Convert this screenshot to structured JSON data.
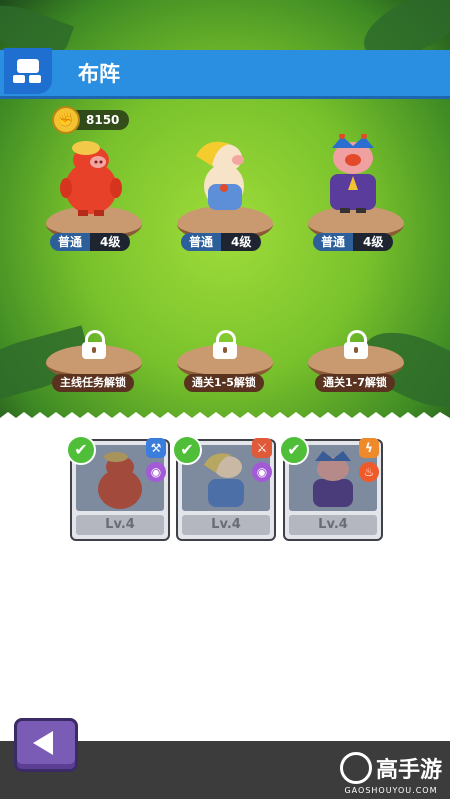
{
  "header": {
    "title": "布阵",
    "icon": "formation-icon"
  },
  "power": {
    "value": "8150",
    "icon": "fist-icon"
  },
  "slots": [
    {
      "quality": "普通",
      "level": "4级",
      "hero": "red-pig"
    },
    {
      "quality": "普通",
      "level": "4级",
      "hero": "blonde-pig"
    },
    {
      "quality": "普通",
      "level": "4级",
      "hero": "clown-pig"
    }
  ],
  "locked_slots": [
    {
      "condition": "主线任务解锁"
    },
    {
      "condition": "通关1-5解锁"
    },
    {
      "condition": "通关1-7解锁"
    }
  ],
  "cards": [
    {
      "level": "Lv.4",
      "selected": true,
      "skills": [
        "hammer-icon",
        "eye-icon"
      ]
    },
    {
      "level": "Lv.4",
      "selected": true,
      "skills": [
        "sword-icon",
        "eye-icon"
      ]
    },
    {
      "level": "Lv.4",
      "selected": true,
      "skills": [
        "lightning-icon",
        "fire-icon"
      ]
    }
  ],
  "watermark": {
    "name": "高手游",
    "url": "GAOSHOUYOU.COM"
  },
  "colors": {
    "header": "#2a8fe0",
    "check": "#4fbf3a",
    "back_button": "#7a5bb5"
  }
}
